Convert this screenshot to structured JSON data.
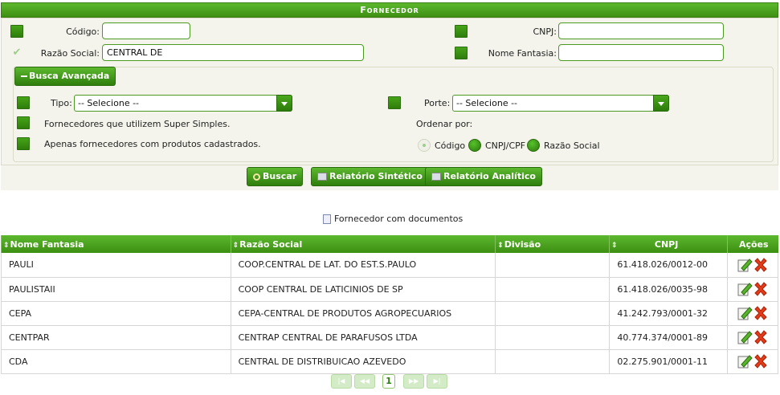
{
  "header": {
    "title": "Fornecedor"
  },
  "filters": {
    "codigo_label": "Código:",
    "codigo_value": "",
    "cnpj_label": "CNPJ:",
    "cnpj_value": "",
    "razao_label": "Razão Social:",
    "razao_value": "CENTRAL DE",
    "fantasia_label": "Nome Fantasia:",
    "fantasia_value": ""
  },
  "advanced": {
    "toggle_label": "Busca Avançada",
    "tipo_label": "Tipo:",
    "tipo_value": "-- Selecione --",
    "porte_label": "Porte:",
    "porte_value": "-- Selecione --",
    "super_simples_label": "Fornecedores que utilizem Super Simples.",
    "produtos_label": "Apenas fornecedores com produtos cadastrados.",
    "ordenar_label": "Ordenar por:",
    "order_options": [
      "Código",
      "CNPJ/CPF",
      "Razão Social"
    ],
    "order_selected": "Código"
  },
  "actions": {
    "buscar": "Buscar",
    "sintetico": "Relatório Sintético",
    "analitico": "Relatório Analítico"
  },
  "docs_link": "Fornecedor com documentos",
  "table": {
    "columns": [
      "Nome Fantasia",
      "Razão Social",
      "Divisão",
      "",
      "CNPJ",
      "Ações"
    ],
    "rows": [
      {
        "fantasia": "PAULI",
        "razao": "COOP.CENTRAL DE LAT. DO EST.S.PAULO",
        "divisao": "",
        "cnpj": "61.418.026/0012-00"
      },
      {
        "fantasia": "PAULISTAII",
        "razao": "COOP CENTRAL DE LATICINIOS DE SP",
        "divisao": "",
        "cnpj": "61.418.026/0035-98"
      },
      {
        "fantasia": "CEPA",
        "razao": "CEPA-CENTRAL DE PRODUTOS AGROPECUARIOS",
        "divisao": "",
        "cnpj": "41.242.793/0001-32"
      },
      {
        "fantasia": "CENTPAR",
        "razao": "CENTRAP CENTRAL DE PARAFUSOS LTDA",
        "divisao": "",
        "cnpj": "40.774.374/0001-89"
      },
      {
        "fantasia": "CDA",
        "razao": "CENTRAL DE DISTRIBUICAO AZEVEDO",
        "divisao": "",
        "cnpj": "02.275.901/0001-11"
      }
    ]
  },
  "pagination": {
    "current_page": "1"
  }
}
